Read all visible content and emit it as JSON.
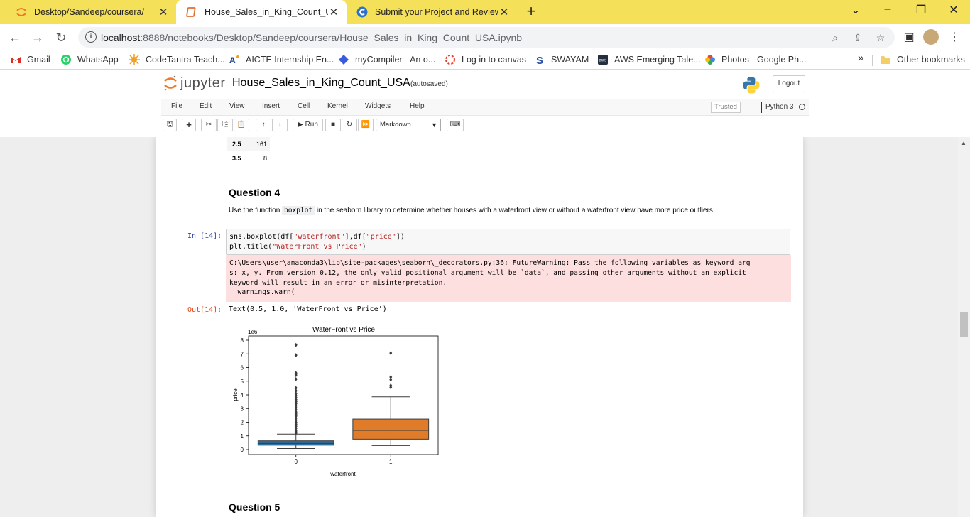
{
  "browser": {
    "tabs": [
      {
        "label": "Desktop/Sandeep/coursera/",
        "icon": "jupyter-icon",
        "active": false
      },
      {
        "label": "House_Sales_in_King_Count_USA",
        "icon": "notebook-icon",
        "active": true
      },
      {
        "label": "Submit your Project and Review",
        "icon": "coursera-icon",
        "active": false
      }
    ],
    "new_tab": "+",
    "window_controls": [
      "⌄",
      "–",
      "❐",
      "✕"
    ],
    "url_host": "localhost",
    "url_path": ":8888/notebooks/Desktop/Sandeep/coursera/House_Sales_in_King_Count_USA.ipynb",
    "bookmarks": [
      {
        "label": "Gmail",
        "icon": "gmail-icon"
      },
      {
        "label": "WhatsApp",
        "icon": "whatsapp-icon"
      },
      {
        "label": "CodeTantra Teach...",
        "icon": "codetantra-icon"
      },
      {
        "label": "AICTE Internship En...",
        "icon": "aicte-icon"
      },
      {
        "label": "myCompiler - An o...",
        "icon": "mycompiler-icon"
      },
      {
        "label": "Log in to canvas",
        "icon": "canvas-icon"
      },
      {
        "label": "SWAYAM",
        "icon": "swayam-icon"
      },
      {
        "label": "AWS Emerging Tale...",
        "icon": "aws-icon"
      },
      {
        "label": "Photos - Google Ph...",
        "icon": "photos-icon"
      }
    ],
    "more_bookmarks": "»",
    "other_bookmarks": "Other bookmarks"
  },
  "jupyter": {
    "logo_text": "jupyter",
    "notebook_name": "House_Sales_in_King_Count_USA",
    "autosave": "(autosaved)",
    "logout": "Logout",
    "menu": [
      "File",
      "Edit",
      "View",
      "Insert",
      "Cell",
      "Kernel",
      "Widgets",
      "Help"
    ],
    "trusted": "Trusted",
    "kernel": "Python 3",
    "run_label": "Run",
    "cell_type": "Markdown"
  },
  "notebook": {
    "table_rows": [
      {
        "index": "2.5",
        "value": "161"
      },
      {
        "index": "3.5",
        "value": "8"
      }
    ],
    "question4_heading": "Question 4",
    "question4_text_before": "Use the function ",
    "question4_code": "boxplot",
    "question4_text_after": " in the seaborn library to determine whether houses with a waterfront view or without a waterfront view have more price outliers.",
    "in_prompt": "In [14]:",
    "code_lines": [
      [
        "sns.boxplot(df[",
        "\"waterfront\"",
        "],df[",
        "\"price\"",
        "])"
      ],
      [
        "plt.title(",
        "\"WaterFront vs Price\"",
        ")"
      ]
    ],
    "stderr": "C:\\Users\\user\\anaconda3\\lib\\site-packages\\seaborn\\_decorators.py:36: FutureWarning: Pass the following variables as keyword arg\ns: x, y. From version 0.12, the only valid positional argument will be `data`, and passing other arguments without an explicit\nkeyword will result in an error or misinterpretation.\n  warnings.warn(",
    "out_prompt": "Out[14]:",
    "out_text": "Text(0.5, 1.0, 'WaterFront vs Price')",
    "question5_heading": "Question 5"
  },
  "chart_data": {
    "type": "box",
    "title": "WaterFront vs Price",
    "xlabel": "waterfront",
    "ylabel": "price",
    "y_multiplier_label": "1e6",
    "ylim": [
      0,
      8
    ],
    "yticks": [
      0,
      1,
      2,
      3,
      4,
      5,
      6,
      7,
      8
    ],
    "categories": [
      "0",
      "1"
    ],
    "boxes": [
      {
        "category": "0",
        "color": "#2f6f9e",
        "whisker_low": 0.08,
        "q1": 0.32,
        "median": 0.45,
        "q3": 0.64,
        "whisker_high": 1.13,
        "outliers": [
          7.65,
          6.9,
          5.6,
          5.45,
          5.15,
          4.5,
          4.3,
          4.1,
          3.95,
          3.8,
          3.65,
          3.5,
          3.35,
          3.2,
          3.05,
          2.9,
          2.75,
          2.6,
          2.45,
          2.3,
          2.15,
          2.0,
          1.85,
          1.7,
          1.55,
          1.4,
          1.3,
          1.2
        ]
      },
      {
        "category": "1",
        "color": "#e07b29",
        "whisker_low": 0.29,
        "q1": 0.76,
        "median": 1.4,
        "q3": 2.23,
        "whisker_high": 3.86,
        "outliers": [
          7.06,
          5.3,
          5.11,
          4.68,
          4.55
        ]
      }
    ]
  }
}
